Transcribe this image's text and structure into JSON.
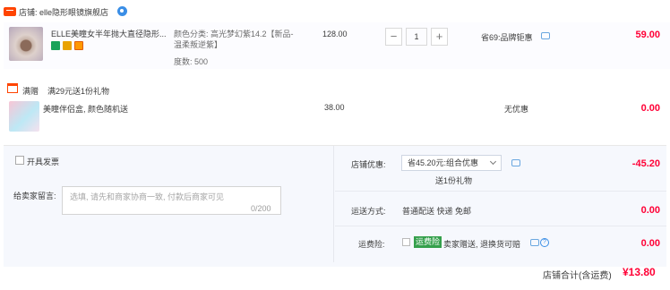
{
  "shop": {
    "label": "店铺:",
    "name": "elle隐形眼镜旗舰店"
  },
  "item": {
    "title": "ELLE美瞳女半年抛大直径隐形...",
    "sku_color_label": "颜色分类: 高光梦幻紫14.2【新品-温柔叛逆紫】",
    "sku_degree": "度数: 500",
    "unit_price": "128.00",
    "quantity": "1",
    "promo": "省69:品牌钜惠",
    "subtotal": "59.00"
  },
  "gift_section": {
    "badge": "满赠",
    "rule": "满29元送1份礼物",
    "gift_title": "美瞳伴侣盒, 颜色随机送",
    "gift_price": "38.00",
    "gift_promo": "无优惠",
    "gift_subtotal": "0.00"
  },
  "invoice": {
    "label": "开具发票"
  },
  "message": {
    "label": "给卖家留言:",
    "placeholder": "选填, 请先和商家协商一致, 付款后商家可见",
    "count": "0/200"
  },
  "discount": {
    "label": "店铺优惠:",
    "selected": "省45.20元:组合优惠",
    "note": "送1份礼物",
    "amount": "-45.20"
  },
  "shipping": {
    "label": "运送方式:",
    "value": "普通配送 快递 免邮",
    "amount": "0.00"
  },
  "insurance": {
    "label": "运费险:",
    "tag": "运费险",
    "desc": "卖家赠送, 退换货可赔",
    "amount": "0.00"
  },
  "total": {
    "label": "店铺合计(含运费)",
    "value": "¥13.80"
  },
  "colors": {
    "accent_red": "#ff0036",
    "tmall_orange": "#ff4400",
    "insurance_green": "#35a04c",
    "link_blue": "#3a8ee6"
  }
}
